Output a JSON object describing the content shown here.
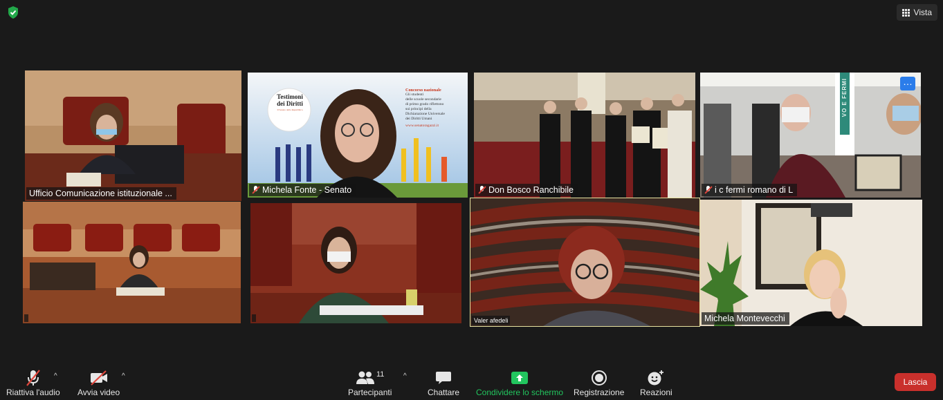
{
  "top_bar": {
    "view_label": "Vista"
  },
  "tiles": [
    {
      "name": "Ufficio Comunicazione istituzionale ..."
    },
    {
      "name": "Michela Fonte - Senato",
      "poster": {
        "badge_line1": "Testimoni",
        "badge_line2": "dei Diritti",
        "badge_small": "Il Senato della Repubblica",
        "heading": "Concorso nazionale",
        "body": [
          "Gli studenti",
          "delle scuole secondarie",
          "di primo grado riflettono",
          "sui principi della",
          "Dichiarazione Universale",
          "dei Diritti Umani"
        ],
        "url": "www.senatoragazzi.it"
      }
    },
    {
      "name": "Don Bosco Ranchibile"
    },
    {
      "name": "i c fermi romano di L",
      "banner_text": "VO E FERMI"
    },
    {
      "name": ""
    },
    {
      "name": ""
    },
    {
      "name": "Valer afedeli"
    },
    {
      "name": "Michela Montevecchi"
    }
  ],
  "toolbar": {
    "audio_label": "Riattiva l'audio",
    "video_label": "Avvia video",
    "participants_label": "Partecipanti",
    "participants_count": "11",
    "chat_label": "Chattare",
    "share_label": "Condividere lo schermo",
    "record_label": "Registrazione",
    "reactions_label": "Reazioni",
    "leave_label": "Lascia"
  },
  "colors": {
    "background": "#1a1a1a",
    "share_green": "#22c55e",
    "leave_red": "#c9302c",
    "active_border": "#e9e3a0"
  }
}
